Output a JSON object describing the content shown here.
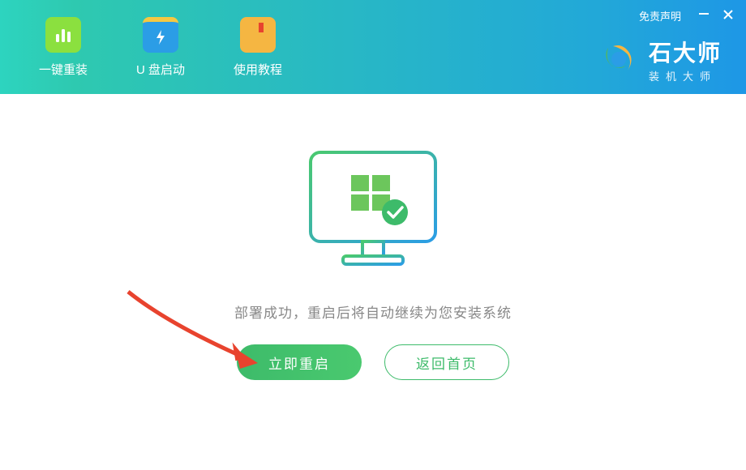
{
  "header": {
    "tabs": [
      {
        "label": "一键重装",
        "icon": "chart-bars"
      },
      {
        "label": "U 盘启动",
        "icon": "usb-lightning"
      },
      {
        "label": "使用教程",
        "icon": "book"
      }
    ],
    "disclaimer": "免责声明",
    "brand": {
      "title": "石大师",
      "subtitle": "装机大师"
    }
  },
  "main": {
    "status_text": "部署成功，重启后将自动继续为您安装系统",
    "restart_label": "立即重启",
    "home_label": "返回首页"
  },
  "colors": {
    "accent_green": "#3dbb6a",
    "header_gradient_start": "#2dd4bf",
    "header_gradient_end": "#1e97e6"
  }
}
